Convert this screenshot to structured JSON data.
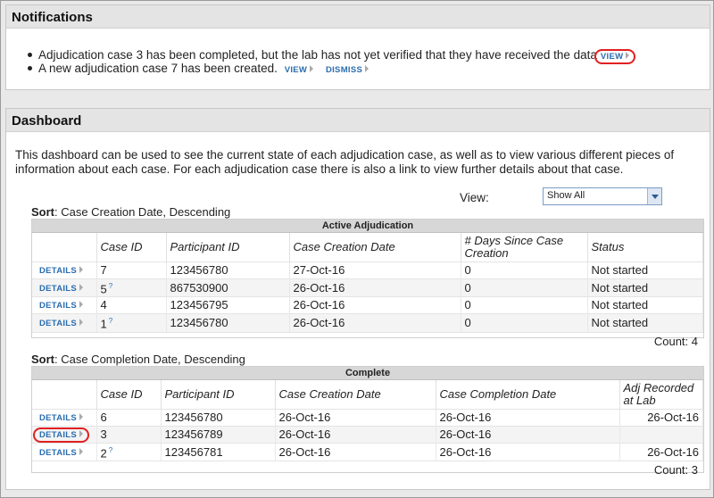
{
  "notifications": {
    "title": "Notifications",
    "items": [
      {
        "text": "Adjudication case 3 has been completed, but the lab has not yet verified that they have received the data",
        "links": [
          "VIEW"
        ]
      },
      {
        "text": "A new adjudication case 7 has been created.",
        "links": [
          "VIEW",
          "DISMISS"
        ]
      }
    ]
  },
  "dashboard": {
    "title": "Dashboard",
    "description": "This dashboard can be used to see the current state of each adjudication case, as well as to view various different pieces of information about each case. For each adjudication case there is also a link to view further details about that case.",
    "view_label": "View:",
    "view_value": "Show All",
    "details_label": "DETAILS",
    "active": {
      "sort_label": "Sort",
      "sort_value": ": Case Creation Date, Descending",
      "caption": "Active Adjudication",
      "headers": [
        "Case ID",
        "Participant ID",
        "Case Creation Date",
        "# Days Since Case Creation",
        "Status"
      ],
      "rows": [
        {
          "case_id": "7",
          "sup": "",
          "participant": "123456780",
          "created": "27-Oct-16",
          "days": "0",
          "status": "Not started"
        },
        {
          "case_id": "5",
          "sup": "?",
          "participant": "867530900",
          "created": "26-Oct-16",
          "days": "0",
          "status": "Not started"
        },
        {
          "case_id": "4",
          "sup": "",
          "participant": "123456795",
          "created": "26-Oct-16",
          "days": "0",
          "status": "Not started"
        },
        {
          "case_id": "1",
          "sup": "?",
          "participant": "123456780",
          "created": "26-Oct-16",
          "days": "0",
          "status": "Not started"
        }
      ],
      "count": "Count: 4"
    },
    "complete": {
      "sort_label": "Sort",
      "sort_value": ": Case Completion Date, Descending",
      "caption": "Complete",
      "headers": [
        "Case ID",
        "Participant ID",
        "Case Creation Date",
        "Case Completion Date",
        "Adj Recorded at Lab"
      ],
      "rows": [
        {
          "case_id": "6",
          "sup": "",
          "participant": "123456780",
          "created": "26-Oct-16",
          "completed": "26-Oct-16",
          "recorded": "26-Oct-16"
        },
        {
          "case_id": "3",
          "sup": "",
          "participant": "123456789",
          "created": "26-Oct-16",
          "completed": "26-Oct-16",
          "recorded": ""
        },
        {
          "case_id": "2",
          "sup": "?",
          "participant": "123456781",
          "created": "26-Oct-16",
          "completed": "26-Oct-16",
          "recorded": "26-Oct-16"
        }
      ],
      "count": "Count: 3"
    }
  }
}
